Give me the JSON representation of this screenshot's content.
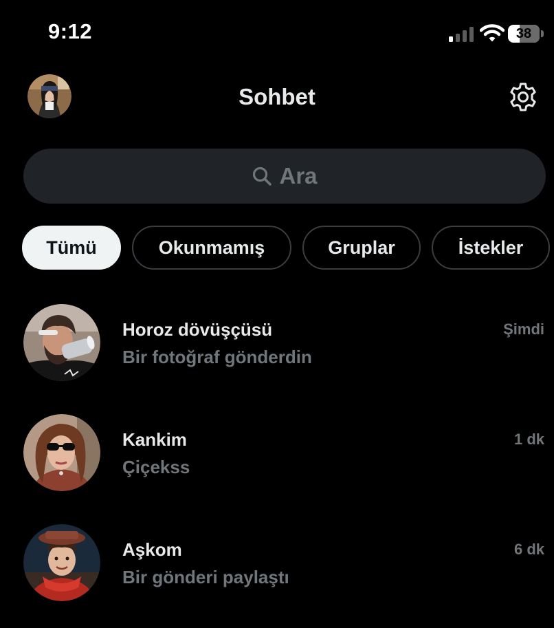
{
  "status_bar": {
    "time": "9:12",
    "battery_level": "38",
    "battery_fraction": 0.38
  },
  "header": {
    "title": "Sohbet",
    "settings_icon": "gear-icon",
    "profile_avatar": "user-avatar"
  },
  "search": {
    "placeholder": "Ara",
    "icon": "search-icon"
  },
  "filters": [
    {
      "label": "Tümü",
      "active": true
    },
    {
      "label": "Okunmamış",
      "active": false
    },
    {
      "label": "Gruplar",
      "active": false
    },
    {
      "label": "İstekler",
      "active": false
    }
  ],
  "conversations": [
    {
      "name": "Horoz dövüşçüsü",
      "preview": "Bir fotoğraf gönderdin",
      "time": "Şimdi"
    },
    {
      "name": "Kankim",
      "preview": "Çiçekss",
      "time": "1 dk"
    },
    {
      "name": "Aşkom",
      "preview": "Bir gönderi paylaştı",
      "time": "6 dk"
    }
  ],
  "colors": {
    "background": "#000000",
    "primary_text": "#e7e9ea",
    "secondary_text": "#71767b",
    "search_fill": "#202327",
    "chip_border": "#3a3d41",
    "active_chip_fill": "#eff3f4"
  }
}
